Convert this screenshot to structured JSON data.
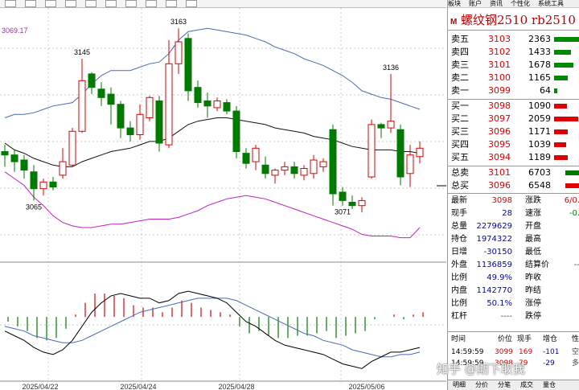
{
  "window": {
    "toolbar_icons": [
      "chart-icon",
      "zoom-icon",
      "layout-icon",
      "table-icon",
      "grid-icon",
      "flag-icon",
      "window-icon",
      "list-icon",
      "menu-icon",
      "dots-icon"
    ],
    "panel_menu": [
      "板块",
      "账户",
      "资讯",
      "个性化",
      "系统工具"
    ]
  },
  "chart": {
    "top_value": "3069.17",
    "price_labels": {
      "high1": "3145",
      "high2": "3163",
      "high3": "3136",
      "low1": "3065",
      "low2": "3071"
    },
    "dates": [
      "2025/04/22",
      "2025/04/24",
      "2025/04/28",
      "2025/05/06"
    ],
    "colors": {
      "up": "#e00000",
      "down": "#007a00",
      "upper_band": "#4a6ab4",
      "middle_band": "#111111",
      "lower_band": "#c020c0",
      "macd_line": "#000000",
      "signal_line": "#4a6ab4"
    }
  },
  "chart_data": {
    "type": "candlestick",
    "title": "",
    "ylim": [
      3025,
      3175
    ],
    "candles": [
      {
        "o": 3090,
        "h": 3094,
        "l": 3081,
        "c": 3088
      },
      {
        "o": 3088,
        "h": 3091,
        "l": 3078,
        "c": 3084
      },
      {
        "o": 3085,
        "h": 3088,
        "l": 3074,
        "c": 3079
      },
      {
        "o": 3078,
        "h": 3082,
        "l": 3061,
        "c": 3068
      },
      {
        "o": 3068,
        "h": 3074,
        "l": 3064,
        "c": 3072
      },
      {
        "o": 3072,
        "h": 3075,
        "l": 3067,
        "c": 3069
      },
      {
        "o": 3076,
        "h": 3092,
        "l": 3074,
        "c": 3084
      },
      {
        "o": 3082,
        "h": 3104,
        "l": 3081,
        "c": 3102
      },
      {
        "o": 3102,
        "h": 3145,
        "l": 3101,
        "c": 3132
      },
      {
        "o": 3136,
        "h": 3137,
        "l": 3124,
        "c": 3128
      },
      {
        "o": 3127,
        "h": 3131,
        "l": 3117,
        "c": 3122
      },
      {
        "o": 3124,
        "h": 3128,
        "l": 3106,
        "c": 3118
      },
      {
        "o": 3118,
        "h": 3120,
        "l": 3098,
        "c": 3104
      },
      {
        "o": 3104,
        "h": 3108,
        "l": 3096,
        "c": 3100
      },
      {
        "o": 3100,
        "h": 3118,
        "l": 3097,
        "c": 3112
      },
      {
        "o": 3110,
        "h": 3123,
        "l": 3108,
        "c": 3122
      },
      {
        "o": 3120,
        "h": 3123,
        "l": 3090,
        "c": 3095
      },
      {
        "o": 3094,
        "h": 3156,
        "l": 3092,
        "c": 3142
      },
      {
        "o": 3142,
        "h": 3163,
        "l": 3136,
        "c": 3155
      },
      {
        "o": 3157,
        "h": 3160,
        "l": 3120,
        "c": 3126
      },
      {
        "o": 3128,
        "h": 3132,
        "l": 3116,
        "c": 3119
      },
      {
        "o": 3120,
        "h": 3125,
        "l": 3110,
        "c": 3117
      },
      {
        "o": 3116,
        "h": 3122,
        "l": 3114,
        "c": 3120
      },
      {
        "o": 3119,
        "h": 3121,
        "l": 3112,
        "c": 3114
      },
      {
        "o": 3114,
        "h": 3117,
        "l": 3086,
        "c": 3090
      },
      {
        "o": 3089,
        "h": 3092,
        "l": 3080,
        "c": 3083
      },
      {
        "o": 3084,
        "h": 3094,
        "l": 3079,
        "c": 3092
      },
      {
        "o": 3082,
        "h": 3087,
        "l": 3074,
        "c": 3077
      },
      {
        "o": 3076,
        "h": 3080,
        "l": 3071,
        "c": 3079
      },
      {
        "o": 3079,
        "h": 3084,
        "l": 3076,
        "c": 3081
      },
      {
        "o": 3081,
        "h": 3084,
        "l": 3074,
        "c": 3077
      },
      {
        "o": 3076,
        "h": 3082,
        "l": 3073,
        "c": 3080
      },
      {
        "o": 3077,
        "h": 3088,
        "l": 3074,
        "c": 3085
      },
      {
        "o": 3081,
        "h": 3086,
        "l": 3078,
        "c": 3084
      },
      {
        "o": 3103,
        "h": 3106,
        "l": 3058,
        "c": 3065
      },
      {
        "o": 3066,
        "h": 3069,
        "l": 3058,
        "c": 3061
      },
      {
        "o": 3060,
        "h": 3064,
        "l": 3056,
        "c": 3058
      },
      {
        "o": 3058,
        "h": 3063,
        "l": 3054,
        "c": 3061
      },
      {
        "o": 3075,
        "h": 3109,
        "l": 3074,
        "c": 3106
      },
      {
        "o": 3106,
        "h": 3107,
        "l": 3098,
        "c": 3104
      },
      {
        "o": 3104,
        "h": 3136,
        "l": 3101,
        "c": 3108
      },
      {
        "o": 3103,
        "h": 3106,
        "l": 3070,
        "c": 3075
      },
      {
        "o": 3077,
        "h": 3094,
        "l": 3069,
        "c": 3088
      },
      {
        "o": 3087,
        "h": 3096,
        "l": 3083,
        "c": 3092
      }
    ],
    "upper_band": [
      3110,
      3112,
      3112,
      3113,
      3115,
      3117,
      3118,
      3119,
      3124,
      3130,
      3135,
      3138,
      3138,
      3138,
      3140,
      3142,
      3143,
      3148,
      3156,
      3161,
      3162,
      3163,
      3162,
      3161,
      3160,
      3159,
      3157,
      3155,
      3152,
      3150,
      3148,
      3145,
      3143,
      3141,
      3138,
      3135,
      3131,
      3126,
      3124,
      3122,
      3121,
      3119,
      3117,
      3115
    ],
    "middle_band": [
      3095,
      3091,
      3089,
      3086,
      3084,
      3082,
      3081,
      3081,
      3084,
      3086,
      3088,
      3090,
      3091,
      3092,
      3094,
      3096,
      3096,
      3098,
      3102,
      3106,
      3108,
      3109,
      3110,
      3110,
      3109,
      3108,
      3107,
      3106,
      3104,
      3103,
      3102,
      3101,
      3099,
      3098,
      3097,
      3095,
      3093,
      3092,
      3091,
      3091,
      3091,
      3090,
      3090,
      3089
    ],
    "lower_band": [
      3078,
      3074,
      3070,
      3063,
      3058,
      3052,
      3048,
      3046,
      3045,
      3045,
      3046,
      3047,
      3047,
      3048,
      3049,
      3050,
      3050,
      3050,
      3051,
      3053,
      3055,
      3058,
      3060,
      3062,
      3063,
      3064,
      3063,
      3062,
      3060,
      3058,
      3056,
      3054,
      3052,
      3050,
      3048,
      3046,
      3044,
      3041,
      3040,
      3040,
      3040,
      3039,
      3039,
      3045
    ],
    "macd_hist": [
      -0.2,
      -0.4,
      -0.6,
      -0.9,
      -1.0,
      -0.9,
      -0.5,
      0.1,
      0.6,
      1.0,
      1.0,
      0.9,
      0.8,
      0.5,
      0.4,
      0.4,
      0.2,
      0.4,
      0.7,
      0.6,
      0.4,
      0.3,
      0.2,
      0.1,
      -0.4,
      -0.7,
      -0.6,
      -0.8,
      -0.9,
      -0.9,
      -0.8,
      -0.8,
      -0.7,
      -0.6,
      -0.9,
      -0.8,
      -0.7,
      -0.6,
      -0.1,
      0.0,
      0.1,
      -0.1,
      0.1,
      0.2
    ],
    "macd_line": [
      -0.6,
      -0.8,
      -1.0,
      -1.3,
      -1.5,
      -1.6,
      -1.4,
      -1.0,
      -0.4,
      0.2,
      0.6,
      0.9,
      1.0,
      0.9,
      0.8,
      0.8,
      0.6,
      0.7,
      1.0,
      1.1,
      1.0,
      0.9,
      0.8,
      0.6,
      0.2,
      -0.2,
      -0.4,
      -0.7,
      -1.0,
      -1.2,
      -1.3,
      -1.4,
      -1.5,
      -1.6,
      -1.8,
      -2.0,
      -2.1,
      -2.2,
      -1.9,
      -1.7,
      -1.5,
      -1.5,
      -1.4,
      -1.3
    ],
    "signal_line": [
      -0.4,
      -0.5,
      -0.6,
      -0.8,
      -0.9,
      -1.0,
      -1.1,
      -1.1,
      -1.0,
      -0.8,
      -0.6,
      -0.4,
      -0.2,
      0.0,
      0.2,
      0.3,
      0.4,
      0.5,
      0.6,
      0.7,
      0.8,
      0.8,
      0.8,
      0.8,
      0.7,
      0.5,
      0.3,
      0.1,
      -0.1,
      -0.3,
      -0.5,
      -0.7,
      -0.8,
      -1.0,
      -1.1,
      -1.2,
      -1.4,
      -1.5,
      -1.6,
      -1.7,
      -1.7,
      -1.6,
      -1.6,
      -1.5
    ],
    "macd_ylim": [
      -2.6,
      2.2
    ]
  },
  "panel": {
    "title_badge": "M",
    "title": "螺纹钢2510  rb2510",
    "asks": [
      {
        "label": "卖五",
        "price": "3103",
        "vol": "2363",
        "bar": 34
      },
      {
        "label": "卖四",
        "price": "3102",
        "vol": "1433",
        "bar": 21
      },
      {
        "label": "卖三",
        "price": "3101",
        "vol": "1678",
        "bar": 24
      },
      {
        "label": "卖二",
        "price": "3100",
        "vol": "1165",
        "bar": 17
      },
      {
        "label": "卖一",
        "price": "3099",
        "vol": "64",
        "bar": 4
      }
    ],
    "bids": [
      {
        "label": "买一",
        "price": "3098",
        "vol": "1090",
        "bar": 16
      },
      {
        "label": "买二",
        "price": "3097",
        "vol": "2059",
        "bar": 30
      },
      {
        "label": "买三",
        "price": "3096",
        "vol": "1171",
        "bar": 17
      },
      {
        "label": "买四",
        "price": "3095",
        "vol": "1039",
        "bar": 15
      },
      {
        "label": "买五",
        "price": "3094",
        "vol": "1189",
        "bar": 17
      }
    ],
    "totals": [
      {
        "label": "总卖",
        "price": "3101",
        "vol": "6703",
        "color": "#007a00"
      },
      {
        "label": "总买",
        "price": "3096",
        "vol": "6548",
        "color": "#e00000"
      }
    ],
    "stats": [
      {
        "l1": "最新",
        "v1": "3098",
        "c1": "red",
        "l2": "涨跌",
        "v2": "6/0.",
        "c2": "red"
      },
      {
        "l1": "现手",
        "v1": "28",
        "c1": "blue",
        "l2": "速涨",
        "v2": "-0.",
        "c2": "green"
      },
      {
        "l1": "总量",
        "v1": "2279629",
        "c1": "blue",
        "l2": "开盘",
        "v2": "",
        "c2": "red"
      },
      {
        "l1": "持仓",
        "v1": "1974322",
        "c1": "blue",
        "l2": "最高",
        "v2": "",
        "c2": "red"
      },
      {
        "l1": "日增",
        "v1": "-30150",
        "c1": "blue",
        "l2": "最低",
        "v2": "",
        "c2": "red"
      },
      {
        "l1": "外盘",
        "v1": "1136859",
        "c1": "blue",
        "l2": "结算价",
        "v2": "--",
        "c2": "grey"
      },
      {
        "l1": "比例",
        "v1": "49.9%",
        "c1": "blue",
        "l2": "昨收",
        "v2": "",
        "c2": "grey"
      },
      {
        "l1": "内盘",
        "v1": "1142770",
        "c1": "blue",
        "l2": "昨结",
        "v2": "",
        "c2": "grey"
      },
      {
        "l1": "比例",
        "v1": "50.1%",
        "c1": "blue",
        "l2": "涨停",
        "v2": "",
        "c2": "red"
      },
      {
        "l1": "杠杆",
        "v1": "----",
        "c1": "grey",
        "l2": "跌停",
        "v2": "",
        "c2": "green"
      }
    ],
    "trades_header": {
      "time": "时间",
      "price": "价位",
      "qty": "现手",
      "chg": "增仓",
      "type": "性"
    },
    "trades": [
      {
        "time": "14:59:59",
        "price": "3099",
        "qty": "169",
        "chg": "-101",
        "type": "空"
      },
      {
        "time": "14:59:59",
        "price": "3098",
        "qty": "79",
        "chg": "-29",
        "type": "多"
      }
    ],
    "tabs": [
      "明细",
      "分价",
      "分笔",
      "成交",
      "量仓"
    ]
  },
  "watermark": "知乎 @期下取我"
}
